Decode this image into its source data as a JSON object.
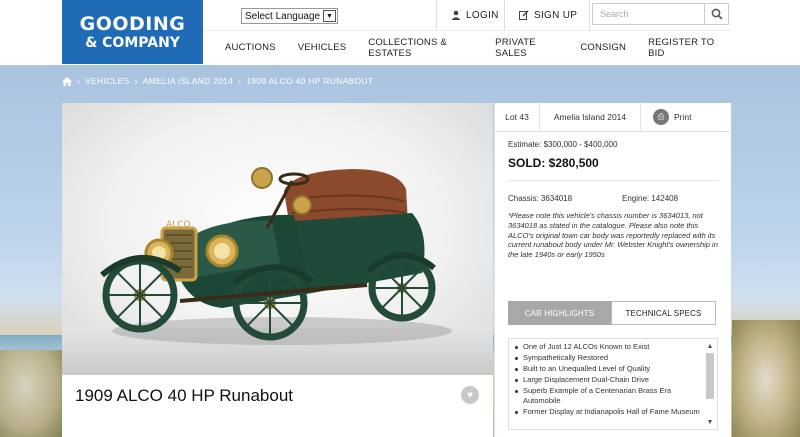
{
  "header": {
    "logo_line1": "GOODING",
    "logo_line2": "& COMPANY",
    "language_select": "Select Language",
    "login": "LOGIN",
    "signup": "SIGN UP",
    "search_placeholder": "Search"
  },
  "nav": [
    "AUCTIONS",
    "VEHICLES",
    "COLLECTIONS & ESTATES",
    "PRIVATE SALES",
    "CONSIGN",
    "REGISTER TO BID"
  ],
  "breadcrumb": [
    "VEHICLES",
    "AMELIA ISLAND 2014",
    "1909 ALCO 40 HP RUNABOUT"
  ],
  "vehicle": {
    "title": "1909 ALCO 40 HP Runabout",
    "lot": "Lot 43",
    "auction": "Amelia Island 2014",
    "print": "Print",
    "estimate": "Estimate: $300,000 - $400,000",
    "sold": "SOLD: $280,500",
    "chassis": "Chassis: 3634018",
    "engine": "Engine: 142408",
    "note": "*Please note this vehicle's chassis number is 3634013, not 3634018 as stated in the catalogue. Please also note this ALCO's original town car body was reportedly replaced with its current runabout body under Mr. Webster Knight's ownership in the late 1940s or early 1950s"
  },
  "tabs": {
    "highlights": "CAR HIGHLIGHTS",
    "specs": "TECHNICAL SPECS"
  },
  "highlights": [
    "One of Just 12 ALCOs Known to Exist",
    "Sympathetically Restored",
    "Built to an Unequalled Level of Quality",
    "Large Displacement Dual-Chain Drive",
    "Superb Example of a Centenarian Brass Era Automobile",
    "Former Display at Indianapolis Hall of Fame Museum"
  ],
  "colors": {
    "brand_blue": "#1f6bb6",
    "tab_active": "#a8a8a8"
  }
}
